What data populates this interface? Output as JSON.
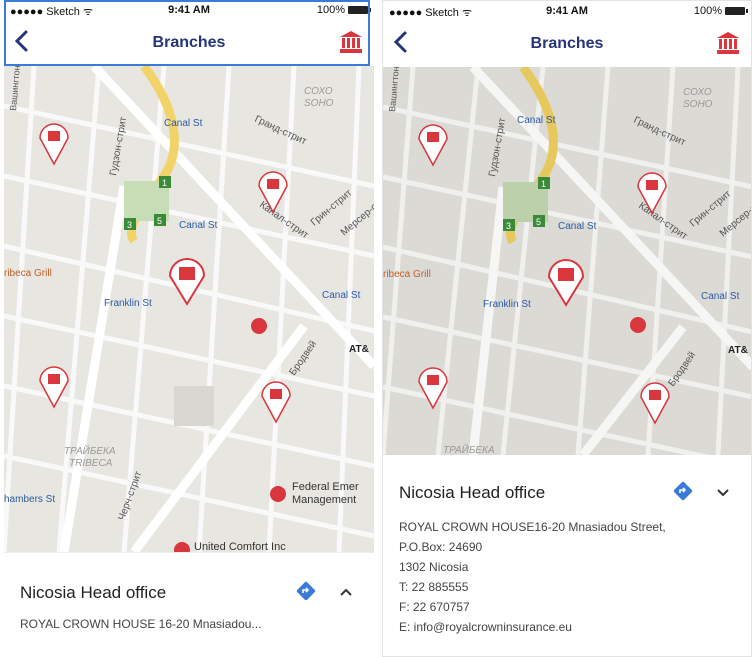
{
  "status": {
    "carrier": "●●●●● Sketch ᯤ",
    "time": "9:41 AM",
    "battery": "100%"
  },
  "nav": {
    "title": "Branches"
  },
  "map": {
    "labels": {
      "soho_ru": "СОХО",
      "soho": "SOHO",
      "canal1": "Canal St",
      "canal2": "Canal St",
      "canal3": "Canal St",
      "franklin": "Franklin St",
      "tribeca_grill": "ribeca Grill",
      "hudson": "Гудзон-стрит",
      "grand": "Гранд-стрит",
      "canal_ru": "Канал-стрит",
      "green": "Грин-стрит",
      "mercer": "Мерсер-ст",
      "broadway": "Бродвей",
      "at": "AT&",
      "tribeca_ru": "ТРАЙБЕКА",
      "tribeca": "TRIBECA",
      "chambers": "hambers St",
      "federal1": "Federal Emer",
      "federal2": "Management",
      "united": "United Comfort Inc",
      "church": "Черч-стрит",
      "wash": "Вашингтон",
      "badge1": "1",
      "badge3": "3",
      "badge5": "5"
    }
  },
  "sheet_collapsed": {
    "name": "Nicosia Head office",
    "address": "ROYAL CROWN HOUSE 16-20 Mnasiadou..."
  },
  "sheet_expanded": {
    "name": "Nicosia Head office",
    "line1": "ROYAL CROWN HOUSE16-20 Mnasiadou Street,",
    "line2": "P.O.Box: 24690",
    "line3": "1302 Nicosia",
    "line4": "T: 22 885555",
    "line5": "F: 22 670757",
    "line6": "E: info@royalcrowninsurance.eu"
  },
  "colors": {
    "accent": "#26357a",
    "pin": "#d9363e",
    "directions": "#3b7bd8"
  }
}
